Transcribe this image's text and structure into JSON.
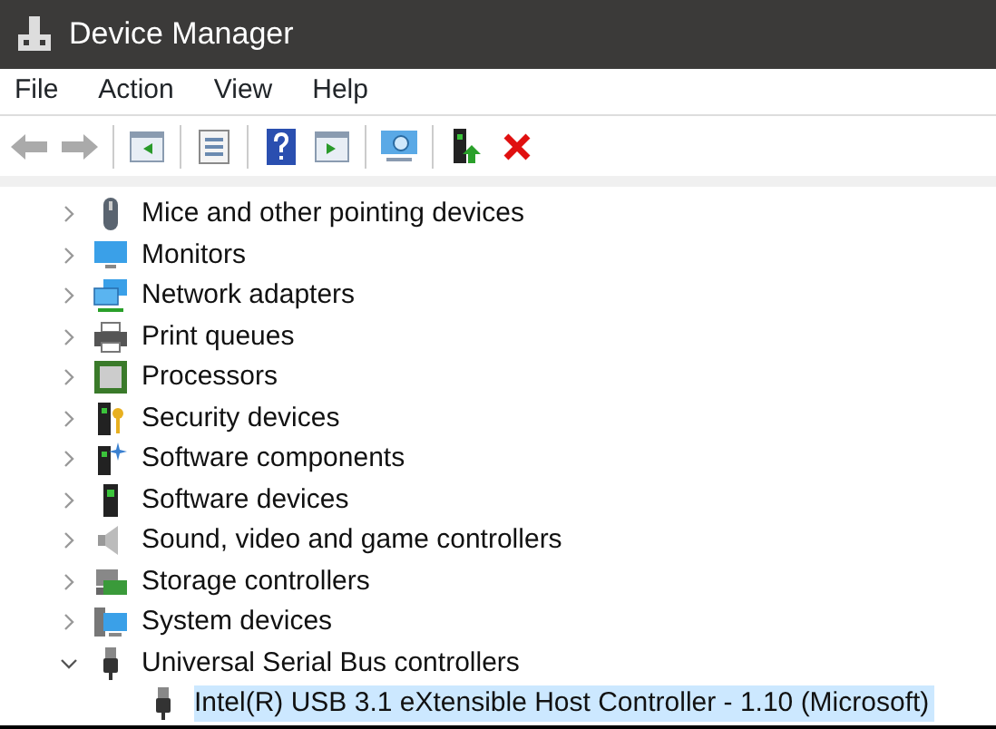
{
  "window": {
    "title": "Device Manager"
  },
  "menu": [
    "File",
    "Action",
    "View",
    "Help"
  ],
  "tree": [
    {
      "label": "Mice and other pointing devices",
      "kind": "mouse",
      "expanded": false,
      "selected": false
    },
    {
      "label": "Monitors",
      "kind": "monitor",
      "expanded": false,
      "selected": false
    },
    {
      "label": "Network adapters",
      "kind": "network",
      "expanded": false,
      "selected": false
    },
    {
      "label": "Print queues",
      "kind": "printer",
      "expanded": false,
      "selected": false
    },
    {
      "label": "Processors",
      "kind": "processor",
      "expanded": false,
      "selected": false
    },
    {
      "label": "Security devices",
      "kind": "security",
      "expanded": false,
      "selected": false
    },
    {
      "label": "Software components",
      "kind": "component",
      "expanded": false,
      "selected": false
    },
    {
      "label": "Software devices",
      "kind": "device",
      "expanded": false,
      "selected": false
    },
    {
      "label": "Sound, video and game controllers",
      "kind": "sound",
      "expanded": false,
      "selected": false
    },
    {
      "label": "Storage controllers",
      "kind": "storage",
      "expanded": false,
      "selected": false
    },
    {
      "label": "System devices",
      "kind": "system",
      "expanded": false,
      "selected": false
    },
    {
      "label": "Universal Serial Bus controllers",
      "kind": "usb",
      "expanded": true,
      "selected": false,
      "children": [
        {
          "label": "Intel(R) USB 3.1 eXtensible Host Controller - 1.10 (Microsoft)",
          "kind": "usb",
          "selected": true
        }
      ]
    }
  ]
}
